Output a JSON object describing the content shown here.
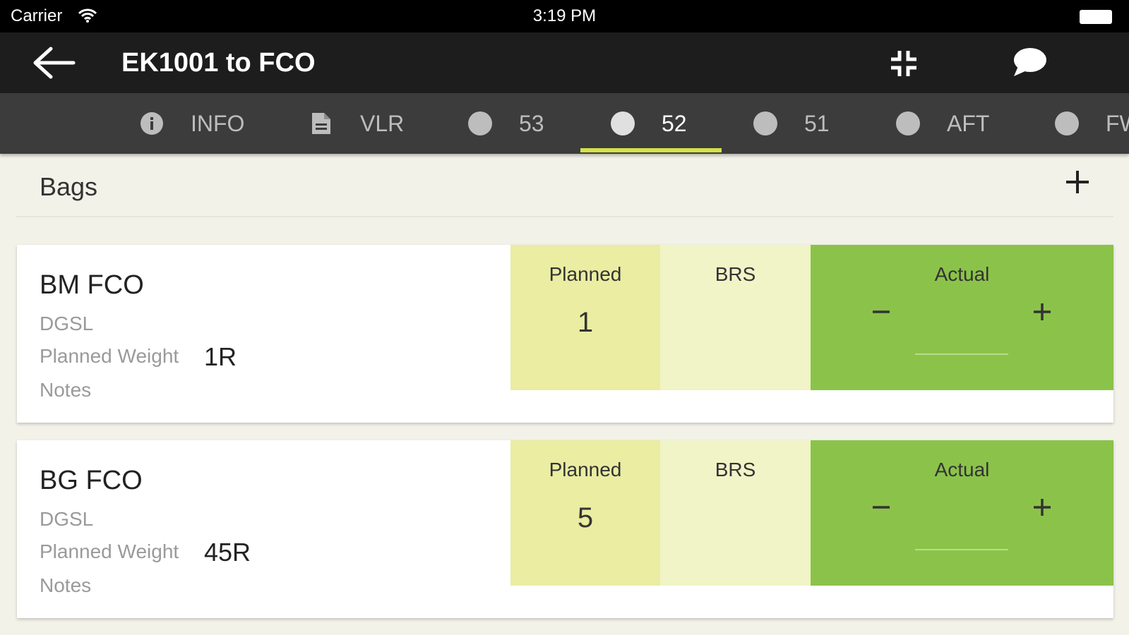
{
  "status_bar": {
    "carrier": "Carrier",
    "time": "3:19 PM"
  },
  "app_bar": {
    "title": "EK1001 to FCO"
  },
  "tabs": [
    {
      "label": "INFO",
      "icon": "info-icon"
    },
    {
      "label": "VLR",
      "icon": "document-icon"
    },
    {
      "label": "53",
      "icon": "dot-icon"
    },
    {
      "label": "52",
      "icon": "dot-icon",
      "active": true
    },
    {
      "label": "51",
      "icon": "dot-icon"
    },
    {
      "label": "AFT",
      "icon": "dot-icon"
    },
    {
      "label": "FWD",
      "icon": "dot-icon"
    }
  ],
  "section": {
    "title": "Bags"
  },
  "labels": {
    "dgsl": "DGSL",
    "planned_weight": "Planned Weight",
    "notes": "Notes",
    "planned": "Planned",
    "brs": "BRS",
    "actual": "Actual",
    "minus": "−",
    "plus": "+"
  },
  "bags": [
    {
      "name": "BM FCO",
      "planned_weight": "1R",
      "planned": "1",
      "brs": "",
      "actual": ""
    },
    {
      "name": "BG FCO",
      "planned_weight": "45R",
      "planned": "5",
      "brs": "",
      "actual": ""
    }
  ],
  "colors": {
    "status_bar": "#000000",
    "app_bar": "#1d1d1d",
    "tab_bar": "#3c3c3c",
    "tab_indicator": "#d6e04a",
    "planned_bg": "#eaeda2",
    "brs_bg": "#f1f4c7",
    "actual_bg": "#8bc34a"
  }
}
